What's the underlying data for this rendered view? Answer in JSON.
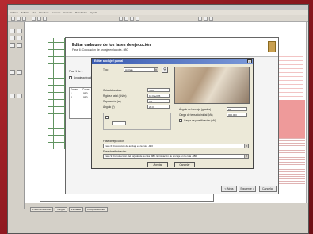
{
  "app": {
    "menu": [
      "Archivo",
      "Edición",
      "Ver",
      "Introducir",
      "Generar",
      "Calcular",
      "Resultados",
      "Ayuda"
    ]
  },
  "wizard": {
    "title": "Editar cada uno de los fases de ejecución",
    "subtitle": "Fase 6: Colocación de andaje en la cota -980",
    "step_label": "Fase 1 de 1",
    "option_label": "Andaje activado",
    "list_header": [
      "Fases",
      "Cotas"
    ],
    "list_rows": [
      [
        "1",
        "-980"
      ],
      [
        "2",
        "-980"
      ]
    ],
    "back_button": "< Atrás",
    "next_button": "Siguiente >",
    "cancel_button": "Cancelar"
  },
  "dialog": {
    "title": "Editar anclaje / puntal",
    "close_glyph": "×",
    "tipo_label": "Tipo",
    "tipo_value": "Anclaje",
    "fields": [
      {
        "label": "Cota del anclaje",
        "value": "-980"
      },
      {
        "label": "Rigidez axial (kN/m)",
        "value": "10.0e+005"
      },
      {
        "label": "Separación (m)",
        "value": "3.0"
      },
      {
        "label": "Ángulo (º)",
        "value": "20.0"
      }
    ],
    "right_fields": [
      {
        "label": "Ángulo del anclaje (grados)",
        "value": "20"
      },
      {
        "label": "Carga de tensado inicial (kN)",
        "value": "000.000"
      }
    ],
    "checkbox_label": "Carga de plastificación (kN)",
    "fase_ejecucion_label": "Fase de ejecución",
    "fase_ejecucion_value": "Fase 6: Colocación de anclaje en la cota -980",
    "fase_eliminacion_label": "Fase de eliminación",
    "fase_eliminacion_value": "Fase 9: Construcción del forjado de la cota -980. Eliminación de anclaje en la cota -980",
    "accept_button": "Aceptar",
    "cancel_button": "Cancelar"
  },
  "bottom_tabs": [
    "Predimensionado",
    "Cargas",
    "Pantallas",
    "Comprobaciones"
  ]
}
